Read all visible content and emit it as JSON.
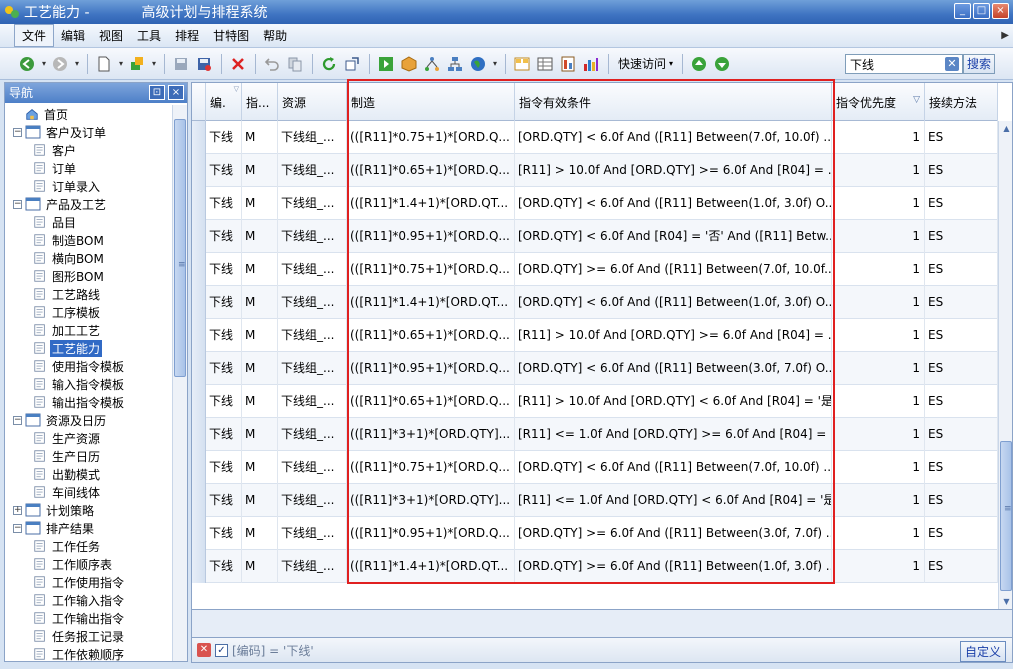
{
  "window": {
    "title": "工艺能力 -",
    "subtitle": "高级计划与排程系统",
    "minimize": "_",
    "maximize": "□",
    "close": "×"
  },
  "menu": [
    "文件",
    "编辑",
    "视图",
    "工具",
    "排程",
    "甘特图",
    "帮助"
  ],
  "toolbar": {
    "quick_access": "快速访问",
    "search_value": "下线",
    "search_button": "搜索"
  },
  "nav": {
    "title": "导航",
    "pin": "⊡",
    "close": "×",
    "items": [
      {
        "label": "首页",
        "level": 0,
        "type": "home"
      },
      {
        "label": "客户及订单",
        "level": 0,
        "type": "folder"
      },
      {
        "label": "客户",
        "level": 1,
        "type": "doc"
      },
      {
        "label": "订单",
        "level": 1,
        "type": "doc"
      },
      {
        "label": "订单录入",
        "level": 1,
        "type": "doc"
      },
      {
        "label": "产品及工艺",
        "level": 0,
        "type": "folder"
      },
      {
        "label": "品目",
        "level": 1,
        "type": "doc"
      },
      {
        "label": "制造BOM",
        "level": 1,
        "type": "doc"
      },
      {
        "label": "横向BOM",
        "level": 1,
        "type": "doc"
      },
      {
        "label": "图形BOM",
        "level": 1,
        "type": "doc"
      },
      {
        "label": "工艺路线",
        "level": 1,
        "type": "doc"
      },
      {
        "label": "工序模板",
        "level": 1,
        "type": "doc"
      },
      {
        "label": "加工工艺",
        "level": 1,
        "type": "doc"
      },
      {
        "label": "工艺能力",
        "level": 1,
        "type": "doc",
        "selected": true
      },
      {
        "label": "使用指令模板",
        "level": 1,
        "type": "doc"
      },
      {
        "label": "输入指令模板",
        "level": 1,
        "type": "doc"
      },
      {
        "label": "输出指令模板",
        "level": 1,
        "type": "doc"
      },
      {
        "label": "资源及日历",
        "level": 0,
        "type": "folder"
      },
      {
        "label": "生产资源",
        "level": 1,
        "type": "doc"
      },
      {
        "label": "生产日历",
        "level": 1,
        "type": "doc"
      },
      {
        "label": "出勤模式",
        "level": 1,
        "type": "doc"
      },
      {
        "label": "车间线体",
        "level": 1,
        "type": "doc"
      },
      {
        "label": "计划策略",
        "level": 0,
        "type": "folder",
        "collapsed": true
      },
      {
        "label": "排产结果",
        "level": 0,
        "type": "folder"
      },
      {
        "label": "工作任务",
        "level": 1,
        "type": "doc"
      },
      {
        "label": "工作顺序表",
        "level": 1,
        "type": "doc"
      },
      {
        "label": "工作使用指令",
        "level": 1,
        "type": "doc"
      },
      {
        "label": "工作输入指令",
        "level": 1,
        "type": "doc"
      },
      {
        "label": "工作输出指令",
        "level": 1,
        "type": "doc"
      },
      {
        "label": "任务报工记录",
        "level": 1,
        "type": "doc"
      },
      {
        "label": "工作依赖顺序",
        "level": 1,
        "type": "doc"
      }
    ]
  },
  "grid": {
    "columns": [
      "编.",
      "指...",
      "资源",
      "制造",
      "指令有效条件",
      "指令优先度",
      "接续方法"
    ],
    "rows": [
      [
        "下线",
        "M",
        "下线组_...",
        "(([R11]*0.75+1)*[ORD.Q...",
        "[ORD.QTY] < 6.0f And ([R11] Between(7.0f, 10.0f) ...",
        "1",
        "ES"
      ],
      [
        "下线",
        "M",
        "下线组_...",
        "(([R11]*0.65+1)*[ORD.Q...",
        "[R11] > 10.0f And [ORD.QTY] >= 6.0f And [R04] = ...",
        "1",
        "ES"
      ],
      [
        "下线",
        "M",
        "下线组_...",
        "(([R11]*1.4+1)*[ORD.QT...",
        "[ORD.QTY] < 6.0f And ([R11] Between(1.0f, 3.0f) O...",
        "1",
        "ES"
      ],
      [
        "下线",
        "M",
        "下线组_...",
        "(([R11]*0.95+1)*[ORD.Q...",
        "[ORD.QTY] < 6.0f And [R04] = '否' And ([R11] Betw...",
        "1",
        "ES"
      ],
      [
        "下线",
        "M",
        "下线组_...",
        "(([R11]*0.75+1)*[ORD.Q...",
        "[ORD.QTY] >= 6.0f And ([R11] Between(7.0f, 10.0f...",
        "1",
        "ES"
      ],
      [
        "下线",
        "M",
        "下线组_...",
        "(([R11]*1.4+1)*[ORD.QT...",
        "[ORD.QTY] < 6.0f And ([R11] Between(1.0f, 3.0f) O...",
        "1",
        "ES"
      ],
      [
        "下线",
        "M",
        "下线组_...",
        "(([R11]*0.65+1)*[ORD.Q...",
        "[R11] > 10.0f And [ORD.QTY] >= 6.0f And [R04] = ...",
        "1",
        "ES"
      ],
      [
        "下线",
        "M",
        "下线组_...",
        "(([R11]*0.95+1)*[ORD.Q...",
        "[ORD.QTY] < 6.0f And ([R11] Between(3.0f, 7.0f) O...",
        "1",
        "ES"
      ],
      [
        "下线",
        "M",
        "下线组_...",
        "(([R11]*0.65+1)*[ORD.Q...",
        "[R11] > 10.0f And [ORD.QTY] < 6.0f And [R04] = '是'",
        "1",
        "ES"
      ],
      [
        "下线",
        "M",
        "下线组_...",
        "(([R11]*3+1)*[ORD.QTY]...",
        "[R11] <= 1.0f And [ORD.QTY] >= 6.0f And [R04] = ...",
        "1",
        "ES"
      ],
      [
        "下线",
        "M",
        "下线组_...",
        "(([R11]*0.75+1)*[ORD.Q...",
        "[ORD.QTY] < 6.0f And ([R11] Between(7.0f, 10.0f) ...",
        "1",
        "ES"
      ],
      [
        "下线",
        "M",
        "下线组_...",
        "(([R11]*3+1)*[ORD.QTY]...",
        "[R11] <= 1.0f And [ORD.QTY] < 6.0f And [R04] = '是'",
        "1",
        "ES"
      ],
      [
        "下线",
        "M",
        "下线组_...",
        "(([R11]*0.95+1)*[ORD.Q...",
        "[ORD.QTY] >= 6.0f And ([R11] Between(3.0f, 7.0f) ...",
        "1",
        "ES"
      ],
      [
        "下线",
        "M",
        "下线组_...",
        "(([R11]*1.4+1)*[ORD.QT...",
        "[ORD.QTY] >= 6.0f And ([R11] Between(1.0f, 3.0f) ...",
        "1",
        "ES"
      ]
    ]
  },
  "filter": {
    "text": "[编码] = '下线'",
    "customize": "自定义"
  }
}
